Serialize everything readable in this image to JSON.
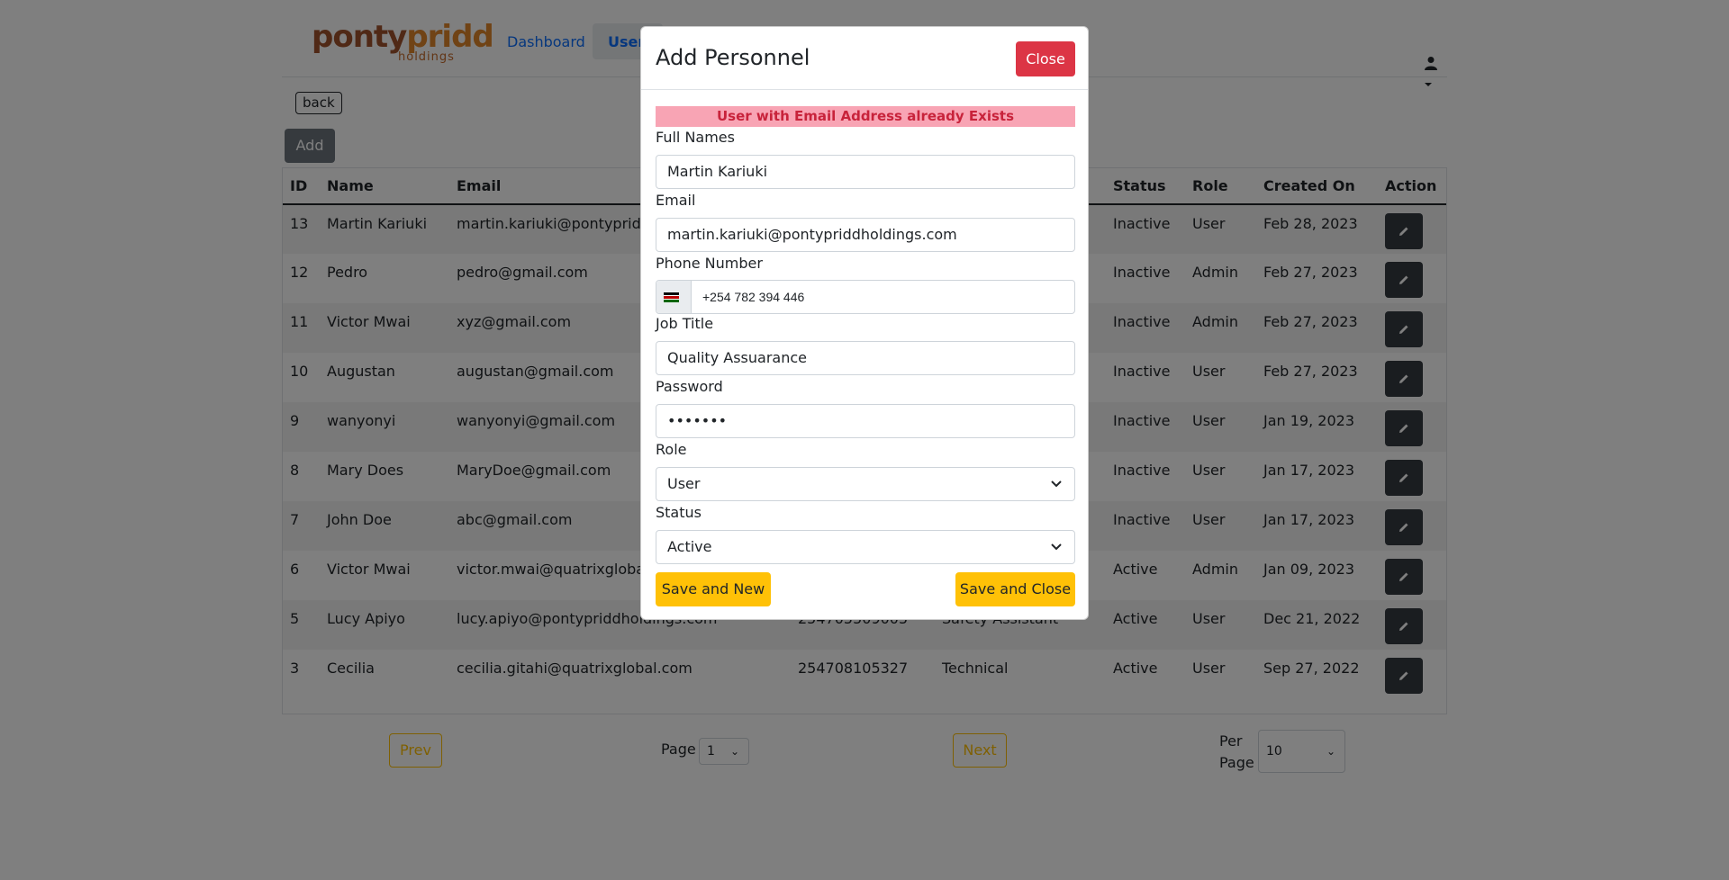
{
  "nav": {
    "logo_part1": "ponty",
    "logo_part2": "pridd",
    "logo_sub": "holdings",
    "dashboard": "Dashboard",
    "users": "Users"
  },
  "toolbar": {
    "back": "back",
    "add": "Add"
  },
  "table": {
    "headers": [
      "ID",
      "Name",
      "Email",
      "Status",
      "Role",
      "Created On",
      "Action"
    ],
    "rows": [
      {
        "id": "13",
        "name": "Martin Kariuki",
        "email": "martin.kariuki@pontypriddho",
        "phone": "",
        "job": "",
        "status": "Inactive",
        "role": "User",
        "created": "Feb 28, 2023"
      },
      {
        "id": "12",
        "name": "Pedro",
        "email": "pedro@gmail.com",
        "phone": "",
        "job": "",
        "status": "Inactive",
        "role": "Admin",
        "created": "Feb 27, 2023"
      },
      {
        "id": "11",
        "name": "Victor Mwai",
        "email": "xyz@gmail.com",
        "phone": "",
        "job": "",
        "status": "Inactive",
        "role": "Admin",
        "created": "Feb 27, 2023"
      },
      {
        "id": "10",
        "name": "Augustan",
        "email": "augustan@gmail.com",
        "phone": "",
        "job": "",
        "status": "Inactive",
        "role": "User",
        "created": "Feb 27, 2023"
      },
      {
        "id": "9",
        "name": "wanyonyi",
        "email": "wanyonyi@gmail.com",
        "phone": "",
        "job": "",
        "status": "Inactive",
        "role": "User",
        "created": "Jan 19, 2023"
      },
      {
        "id": "8",
        "name": "Mary Does",
        "email": "MaryDoe@gmail.com",
        "phone": "",
        "job": "",
        "status": "Inactive",
        "role": "User",
        "created": "Jan 17, 2023"
      },
      {
        "id": "7",
        "name": "John Doe",
        "email": "abc@gmail.com",
        "phone": "",
        "job": "",
        "status": "Inactive",
        "role": "User",
        "created": "Jan 17, 2023"
      },
      {
        "id": "6",
        "name": "Victor Mwai",
        "email": "victor.mwai@quatrixglobal.c",
        "phone": "",
        "job": "",
        "status": "Active",
        "role": "Admin",
        "created": "Jan 09, 2023"
      },
      {
        "id": "5",
        "name": "Lucy Apiyo",
        "email": "lucy.apiyo@pontypriddholdings.com",
        "phone": "254705509005",
        "job": "Safety Assistant",
        "status": "Active",
        "role": "User",
        "created": "Dec 21, 2022"
      },
      {
        "id": "3",
        "name": "Cecilia",
        "email": "cecilia.gitahi@quatrixglobal.com",
        "phone": "254708105327",
        "job": "Technical",
        "status": "Active",
        "role": "User",
        "created": "Sep 27, 2022"
      }
    ]
  },
  "pager": {
    "prev": "Prev",
    "page_label": "Page",
    "page_value": "1",
    "next": "Next",
    "per_page_label_1": "Per",
    "per_page_label_2": "Page",
    "per_page_value": "10"
  },
  "modal": {
    "title": "Add Personnel",
    "close": "Close",
    "alert": "User with Email Address already Exists",
    "full_names_label": "Full Names",
    "full_names_value": "Martin Kariuki",
    "email_label": "Email",
    "email_value": "martin.kariuki@pontypriddholdings.com",
    "phone_label": "Phone Number",
    "phone_value": "+254 782 394 446",
    "job_label": "Job Title",
    "job_value": "Quality Assuarance",
    "password_label": "Password",
    "password_value": "•••••••",
    "role_label": "Role",
    "role_value": "User",
    "status_label": "Status",
    "status_value": "Active",
    "save_new": "Save and New",
    "save_close": "Save and Close"
  },
  "colors": {
    "danger": "#dc3545",
    "warning": "#ffc107",
    "primary": "#0d6efd",
    "dark": "#343a40",
    "alert_bg": "#f8a4b4"
  }
}
